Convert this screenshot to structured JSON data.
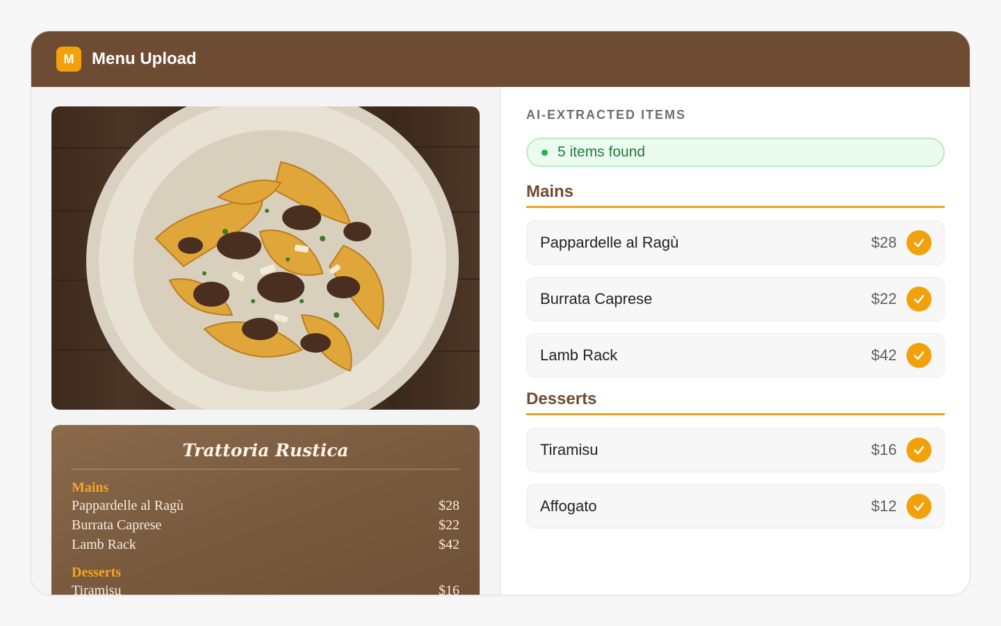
{
  "app": {
    "badge": "M",
    "title": "Menu Upload"
  },
  "menu_card": {
    "title": "Trattoria Rustica",
    "sections": [
      {
        "name": "Mains",
        "items": [
          {
            "name": "Pappardelle al Ragù",
            "price": "$28"
          },
          {
            "name": "Burrata Caprese",
            "price": "$22"
          },
          {
            "name": "Lamb Rack",
            "price": "$42"
          }
        ]
      },
      {
        "name": "Desserts",
        "items": [
          {
            "name": "Tiramisu",
            "price": "$16"
          }
        ]
      }
    ]
  },
  "extracted": {
    "caption": "AI-EXTRACTED ITEMS",
    "status": "5 items found",
    "categories": [
      {
        "name": "Mains",
        "items": [
          {
            "name": "Pappardelle al Ragù",
            "price": "$28",
            "icon": "check-icon"
          },
          {
            "name": "Burrata Caprese",
            "price": "$22",
            "icon": "check-icon"
          },
          {
            "name": "Lamb Rack",
            "price": "$42",
            "icon": "check-icon"
          }
        ]
      },
      {
        "name": "Desserts",
        "items": [
          {
            "name": "Tiramisu",
            "price": "$16",
            "icon": "check-icon"
          },
          {
            "name": "Affogato",
            "price": "$12",
            "icon": "check-icon"
          }
        ]
      }
    ]
  },
  "colors": {
    "header": "#6d4c33",
    "accent": "#f2a10a",
    "success": "#20b54a"
  }
}
